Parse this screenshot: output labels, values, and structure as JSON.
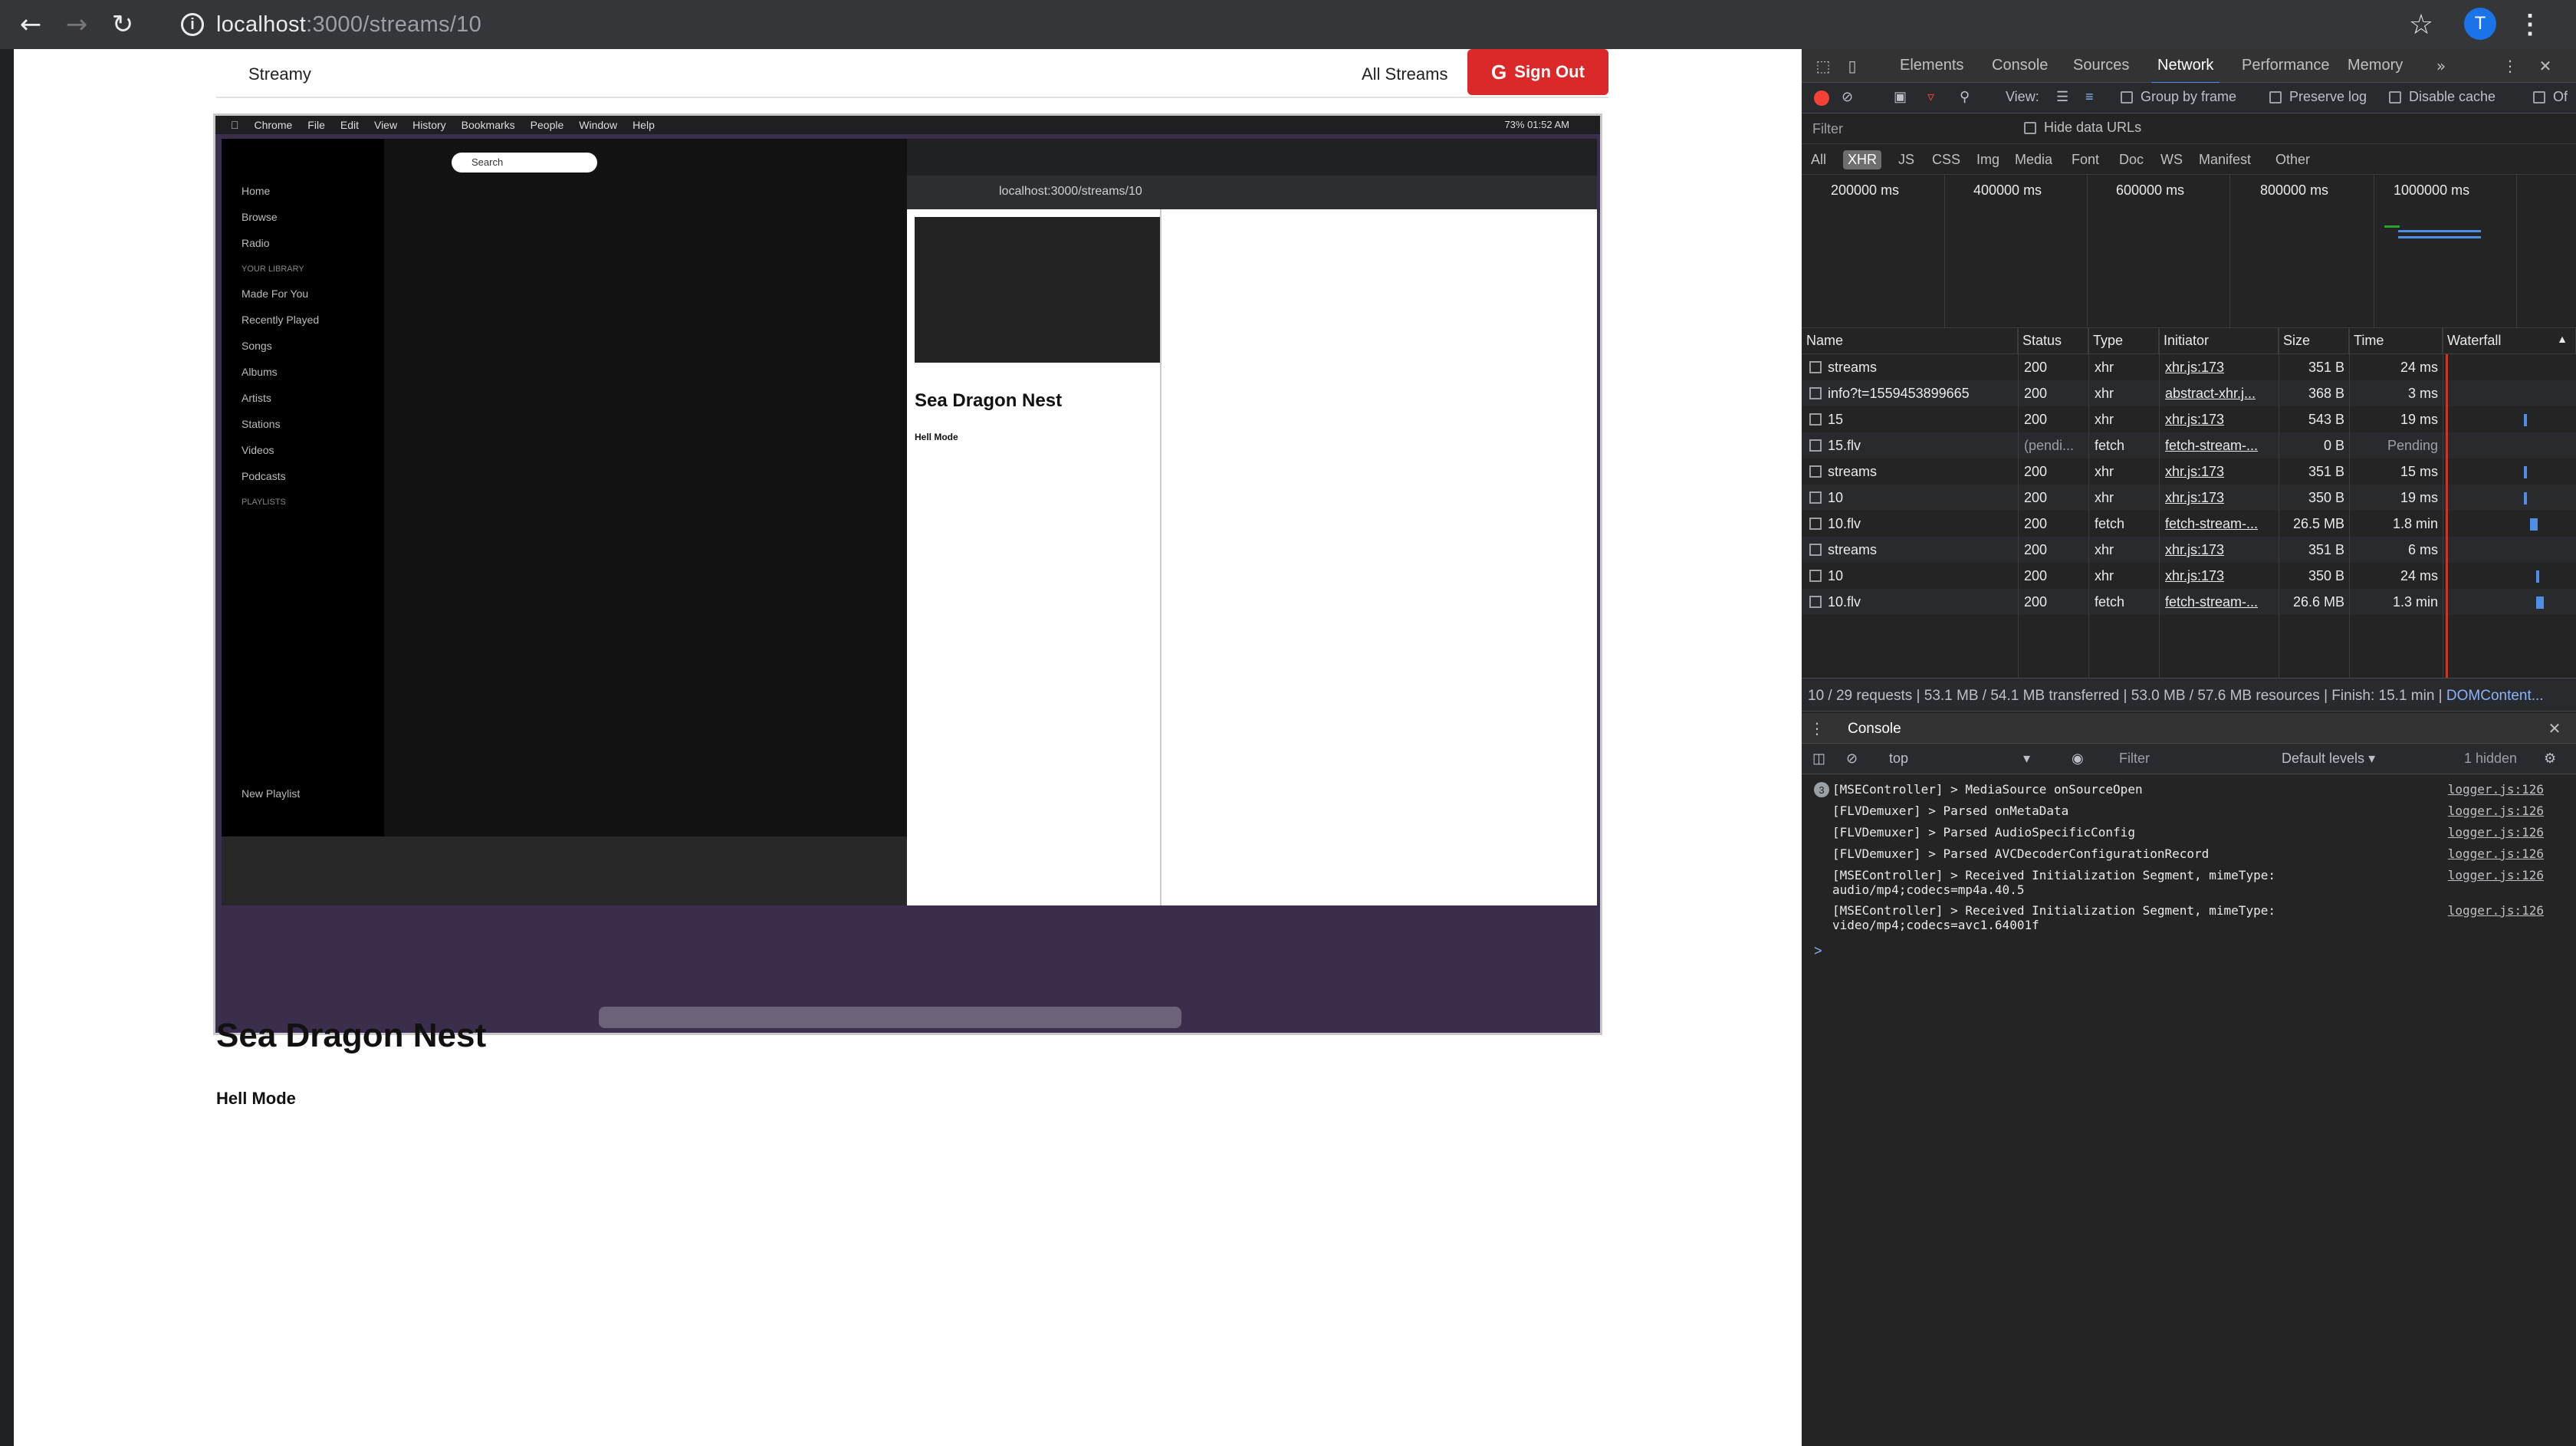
{
  "browser": {
    "url_host": "localhost",
    "url_path": ":3000/streams/10",
    "avatar_letter": "T"
  },
  "app": {
    "brand": "Streamy",
    "nav_all_streams": "All Streams",
    "signout_label": "Sign Out",
    "stream_title": "Sea Dragon Nest",
    "stream_description": "Hell Mode"
  },
  "recording": {
    "menubar": [
      "Chrome",
      "File",
      "Edit",
      "View",
      "History",
      "Bookmarks",
      "People",
      "Window",
      "Help"
    ],
    "status_text": "73%  01:52 AM",
    "spotify_nav": [
      "Home",
      "Browse",
      "Radio"
    ],
    "spotify_library_label": "YOUR LIBRARY",
    "spotify_library": [
      "Made For You",
      "Recently Played",
      "Songs",
      "Albums",
      "Artists",
      "Stations",
      "Videos",
      "Podcasts"
    ],
    "spotify_playlists_label": "PLAYLISTS",
    "spotify_new_playlist": "New Playlist",
    "spotify_search": "Search",
    "inner_url": "localhost:3000/streams/10",
    "inner_title": "Sea Dragon Nest",
    "inner_sub": "Hell Mode"
  },
  "devtools": {
    "tabs": [
      "Elements",
      "Console",
      "Sources",
      "Network",
      "Performance",
      "Memory"
    ],
    "active_tab": "Network",
    "toolbar": {
      "view_label": "View:",
      "group_by_frame": "Group by frame",
      "preserve_log": "Preserve log",
      "disable_cache": "Disable cache",
      "offline": "Of"
    },
    "filter_placeholder": "Filter",
    "hide_data_urls": "Hide data URLs",
    "types": [
      "All",
      "XHR",
      "JS",
      "CSS",
      "Img",
      "Media",
      "Font",
      "Doc",
      "WS",
      "Manifest",
      "Other"
    ],
    "active_type": "XHR",
    "overview_labels": [
      "200000 ms",
      "400000 ms",
      "600000 ms",
      "800000 ms",
      "1000000 ms"
    ],
    "columns": [
      "Name",
      "Status",
      "Type",
      "Initiator",
      "Size",
      "Time",
      "Waterfall"
    ],
    "rows": [
      {
        "name": "streams",
        "status": "200",
        "type": "xhr",
        "initiator": "xhr.js:173",
        "size": "351 B",
        "time": "24 ms"
      },
      {
        "name": "info?t=1559453899665",
        "status": "200",
        "type": "xhr",
        "initiator": "abstract-xhr.j...",
        "size": "368 B",
        "time": "3 ms"
      },
      {
        "name": "15",
        "status": "200",
        "type": "xhr",
        "initiator": "xhr.js:173",
        "size": "543 B",
        "time": "19 ms"
      },
      {
        "name": "15.flv",
        "status": "(pendi...",
        "type": "fetch",
        "initiator": "fetch-stream-...",
        "size": "0 B",
        "time": "Pending"
      },
      {
        "name": "streams",
        "status": "200",
        "type": "xhr",
        "initiator": "xhr.js:173",
        "size": "351 B",
        "time": "15 ms"
      },
      {
        "name": "10",
        "status": "200",
        "type": "xhr",
        "initiator": "xhr.js:173",
        "size": "350 B",
        "time": "19 ms"
      },
      {
        "name": "10.flv",
        "status": "200",
        "type": "fetch",
        "initiator": "fetch-stream-...",
        "size": "26.5 MB",
        "time": "1.8 min"
      },
      {
        "name": "streams",
        "status": "200",
        "type": "xhr",
        "initiator": "xhr.js:173",
        "size": "351 B",
        "time": "6 ms"
      },
      {
        "name": "10",
        "status": "200",
        "type": "xhr",
        "initiator": "xhr.js:173",
        "size": "350 B",
        "time": "24 ms"
      },
      {
        "name": "10.flv",
        "status": "200",
        "type": "fetch",
        "initiator": "fetch-stream-...",
        "size": "26.6 MB",
        "time": "1.3 min"
      }
    ],
    "summary": "10 / 29 requests | 53.1 MB / 54.1 MB transferred | 53.0 MB / 57.6 MB resources | Finish: 15.1 min | ",
    "summary_link": "DOMContent...",
    "console": {
      "tab_label": "Console",
      "context": "top",
      "filter_placeholder": "Filter",
      "levels": "Default levels",
      "hidden": "1 hidden",
      "badge": "3",
      "logs": [
        {
          "msg": "[MSEController] > MediaSource onSourceOpen",
          "src": "logger.js:126"
        },
        {
          "msg": "[FLVDemuxer] > Parsed onMetaData",
          "src": "logger.js:126"
        },
        {
          "msg": "[FLVDemuxer] > Parsed AudioSpecificConfig",
          "src": "logger.js:126"
        },
        {
          "msg": "[FLVDemuxer] > Parsed AVCDecoderConfigurationRecord",
          "src": "logger.js:126"
        },
        {
          "msg": "[MSEController] > Received Initialization Segment, mimeType:\naudio/mp4;codecs=mp4a.40.5",
          "src": "logger.js:126"
        },
        {
          "msg": "[MSEController] > Received Initialization Segment, mimeType:\nvideo/mp4;codecs=avc1.64001f",
          "src": "logger.js:126"
        }
      ],
      "prompt": ">"
    }
  }
}
